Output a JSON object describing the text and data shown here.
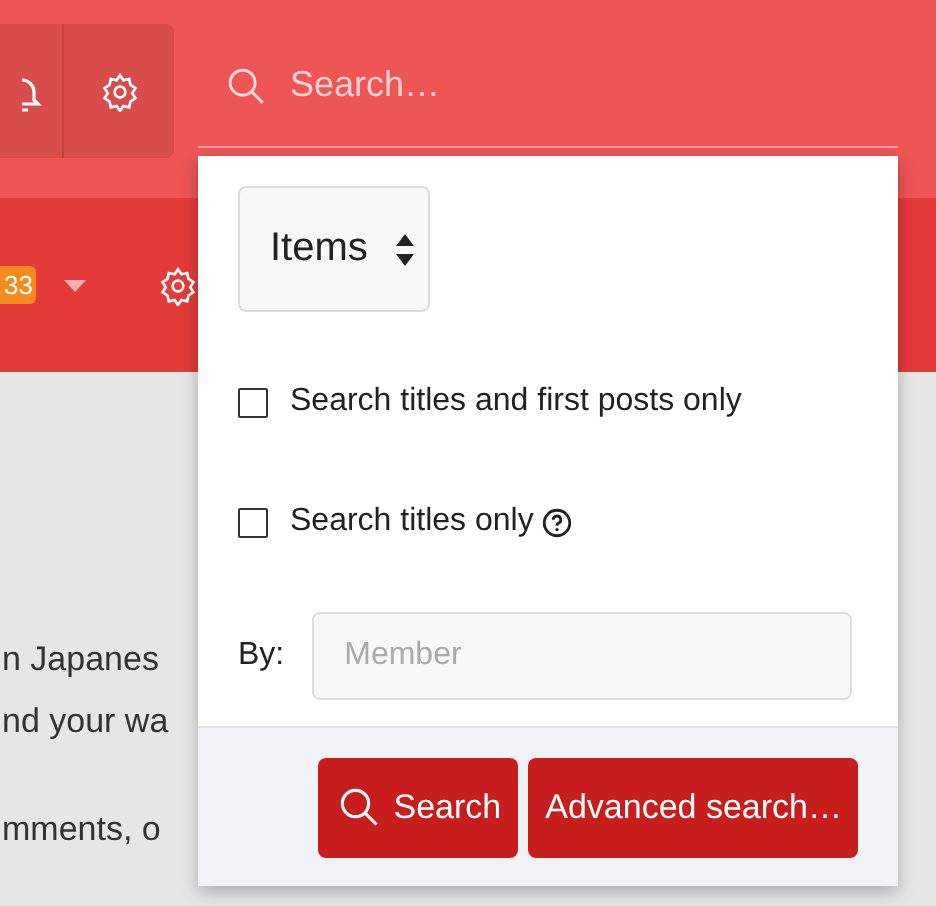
{
  "search": {
    "placeholder": "Search…"
  },
  "nav": {
    "badge": "33"
  },
  "paragraphs": [
    {
      "lines": [
        "n Japanes",
        "nd your wa"
      ]
    },
    {
      "lines": [
        "mments, o"
      ]
    }
  ],
  "popup": {
    "select": {
      "value": "Items"
    },
    "options": [
      {
        "label": "Search titles and first posts only",
        "checked": false,
        "help": false
      },
      {
        "label": "Search titles only",
        "checked": false,
        "help": true
      }
    ],
    "by": {
      "label": "By:",
      "placeholder": "Member"
    },
    "buttons": [
      {
        "label": "Search",
        "kind": "search"
      },
      {
        "label": "Advanced search…",
        "kind": "plain"
      }
    ]
  }
}
